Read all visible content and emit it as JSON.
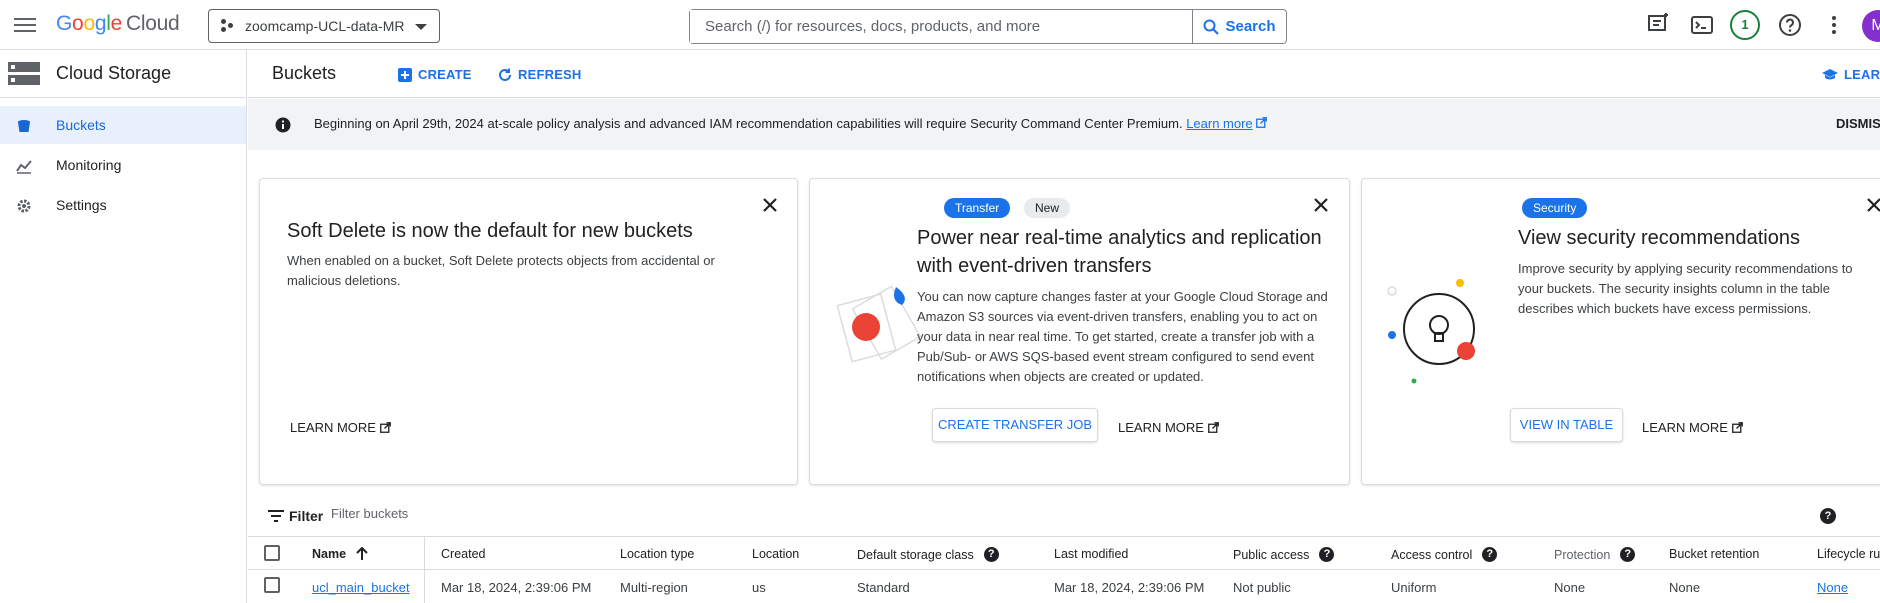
{
  "topbar": {
    "logo_google": "Google",
    "logo_cloud": "Cloud",
    "project": "zoomcamp-UCL-data-MR",
    "search_placeholder": "Search (/) for resources, docs, products, and more",
    "search_button": "Search",
    "notification_count": "1",
    "avatar_letter": "M",
    "colors": {
      "accent": "#1a73e8",
      "avatar": "#8430ce",
      "badge": "#188038"
    }
  },
  "leftnav": {
    "title": "Cloud Storage",
    "items": [
      {
        "label": "Buckets",
        "icon": "bucket-icon",
        "active": true
      },
      {
        "label": "Monitoring",
        "icon": "chart-icon",
        "active": false
      },
      {
        "label": "Settings",
        "icon": "gear-icon",
        "active": false
      }
    ]
  },
  "header": {
    "title": "Buckets",
    "create": "CREATE",
    "refresh": "REFRESH",
    "learn": "LEARN"
  },
  "banner": {
    "text": "Beginning on April 29th, 2024 at-scale policy analysis and advanced IAM recommendation capabilities will require Security Command Center Premium.",
    "link": "Learn more",
    "dismiss": "DISMISS"
  },
  "cards": [
    {
      "title": "Soft Delete is now the default for new buckets",
      "body": "When enabled on a bucket, Soft Delete protects objects from accidental or malicious deletions.",
      "learn_more": "LEARN MORE"
    },
    {
      "chips": [
        "Transfer",
        "New"
      ],
      "title": "Power near real-time analytics and replication with event-driven transfers",
      "body": "You can now capture changes faster at your Google Cloud Storage and Amazon S3 sources via event-driven transfers, enabling you to act on your data in near real time. To get started, create a transfer job with a Pub/Sub- or AWS SQS-based event stream configured to send event notifications when objects are created or updated.",
      "action": "CREATE TRANSFER JOB",
      "learn_more": "LEARN MORE"
    },
    {
      "chips": [
        "Security"
      ],
      "title": "View security recommendations",
      "body": "Improve security by applying security recommendations to your buckets. The security insights column in the table describes which buckets have excess permissions.",
      "action": "VIEW IN TABLE",
      "learn_more": "LEARN MORE"
    }
  ],
  "filter": {
    "label": "Filter",
    "placeholder": "Filter buckets"
  },
  "table": {
    "columns": [
      "Name",
      "Created",
      "Location type",
      "Location",
      "Default storage class",
      "Last modified",
      "Public access",
      "Access control",
      "Protection",
      "Bucket retention",
      "Lifecycle rul"
    ],
    "rows": [
      {
        "name": "ucl_main_bucket",
        "created": "Mar 18, 2024, 2:39:06 PM",
        "location_type": "Multi-region",
        "location": "us",
        "storage_class": "Standard",
        "last_modified": "Mar 18, 2024, 2:39:06 PM",
        "public_access": "Not public",
        "access_control": "Uniform",
        "protection": "None",
        "retention": "None",
        "lifecycle": "None"
      }
    ]
  }
}
